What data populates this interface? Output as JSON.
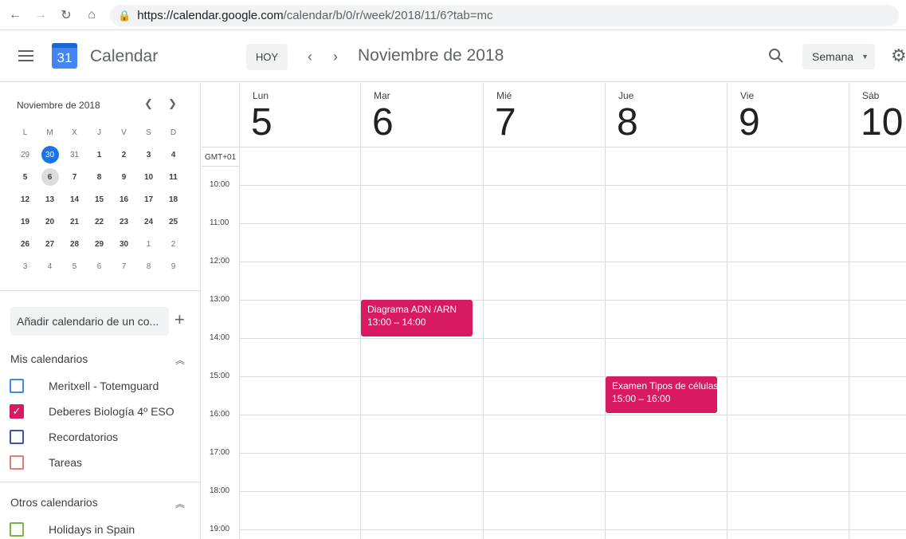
{
  "browser": {
    "url_host": "https://calendar.google.com",
    "url_path": "/calendar/b/0/r/week/2018/11/6?tab=mc"
  },
  "header": {
    "app_title": "Calendar",
    "logo_day": "31",
    "today_label": "HOY",
    "period_title": "Noviembre de 2018",
    "view_label": "Semana"
  },
  "mini_calendar": {
    "month_label": "Noviembre de 2018",
    "weekdays": [
      "L",
      "M",
      "X",
      "J",
      "V",
      "S",
      "D"
    ],
    "weeks": [
      [
        "29",
        "30",
        "31",
        "1",
        "2",
        "3",
        "4"
      ],
      [
        "5",
        "6",
        "7",
        "8",
        "9",
        "10",
        "11"
      ],
      [
        "12",
        "13",
        "14",
        "15",
        "16",
        "17",
        "18"
      ],
      [
        "19",
        "20",
        "21",
        "22",
        "23",
        "24",
        "25"
      ],
      [
        "26",
        "27",
        "28",
        "29",
        "30",
        "1",
        "2"
      ],
      [
        "3",
        "4",
        "5",
        "6",
        "7",
        "8",
        "9"
      ]
    ]
  },
  "sidebar": {
    "add_calendar_placeholder": "Añadir calendario de un co...",
    "my_calendars_title": "Mis calendarios",
    "my_calendars": [
      {
        "label": "Meritxell - Totemguard",
        "color": "#4285f4",
        "checked": false
      },
      {
        "label": "Deberes Biología 4º ESO",
        "color": "#d81b60",
        "checked": true
      },
      {
        "label": "Recordatorios",
        "color": "#3f51b5",
        "checked": false
      },
      {
        "label": "Tareas",
        "color": "#e67c73",
        "checked": false
      }
    ],
    "other_calendars_title": "Otros calendarios",
    "other_calendars": [
      {
        "label": "Holidays in Spain",
        "color": "#7cb342",
        "checked": false
      }
    ]
  },
  "week": {
    "timezone": "GMT+01",
    "days": [
      {
        "dow": "Lun",
        "num": "5"
      },
      {
        "dow": "Mar",
        "num": "6"
      },
      {
        "dow": "Mié",
        "num": "7"
      },
      {
        "dow": "Jue",
        "num": "8"
      },
      {
        "dow": "Vie",
        "num": "9"
      },
      {
        "dow": "Sáb",
        "num": "10"
      }
    ],
    "hours": [
      "10:00",
      "11:00",
      "12:00",
      "13:00",
      "14:00",
      "15:00",
      "16:00",
      "17:00",
      "18:00",
      "19:00"
    ],
    "events": [
      {
        "title": "Diagrama ADN /ARN",
        "time": "13:00 – 14:00",
        "color": "#d81b60"
      },
      {
        "title": "Examen Tipos de células",
        "time": "15:00 – 16:00",
        "color": "#d81b60"
      }
    ]
  }
}
